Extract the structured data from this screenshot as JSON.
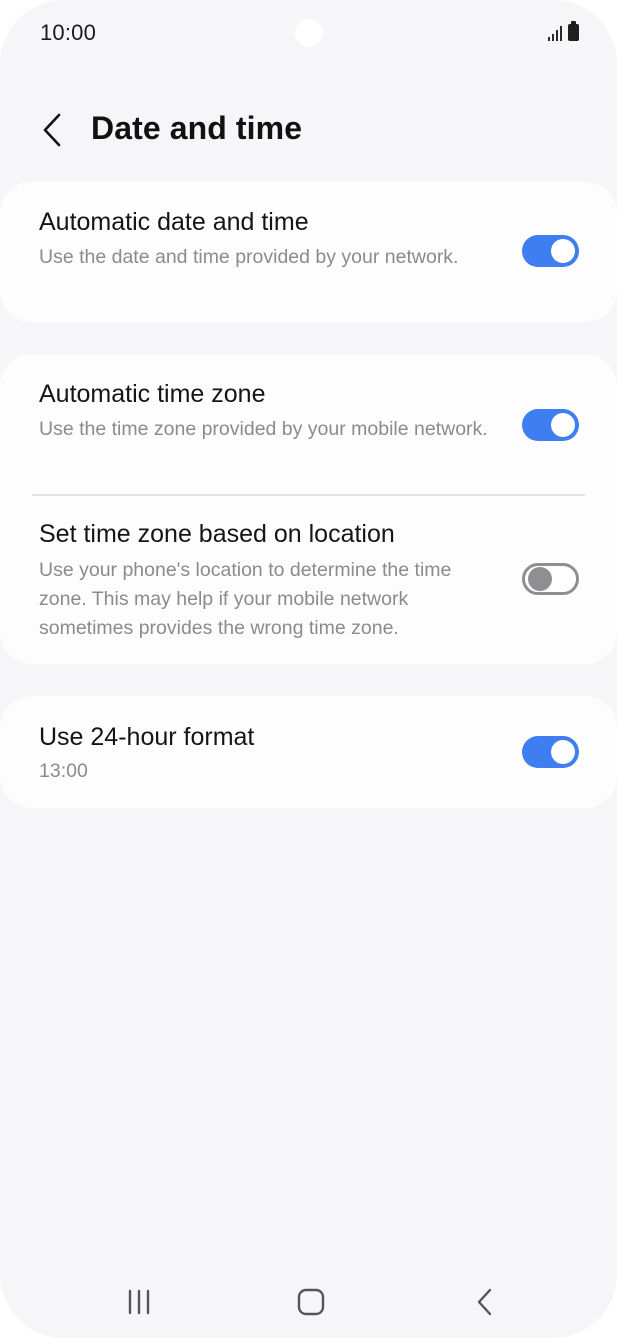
{
  "status_bar": {
    "time": "10:00"
  },
  "header": {
    "title": "Date and time",
    "back_icon": "chevron-left-icon"
  },
  "settings": {
    "automatic_date_time": {
      "title": "Automatic date and time",
      "description": "Use the date and time provided by your network.",
      "enabled": true
    },
    "automatic_time_zone": {
      "title": "Automatic time zone",
      "description": "Use the time zone provided by your mobile network.",
      "enabled": true
    },
    "location_time_zone": {
      "title": "Set time zone based on location",
      "description": "Use your phone's location to determine the time zone. This may help if your mobile network sometimes provides the wrong time zone.",
      "enabled": false
    },
    "hour_format_24": {
      "title": "Use 24-hour format",
      "description": "13:00",
      "enabled": true
    }
  },
  "nav_bar": {
    "recents_icon": "recent-apps-icon",
    "home_icon": "home-icon",
    "back_icon": "back-icon"
  },
  "colors": {
    "accent": "#3e7ef0",
    "background": "#f6f6f8",
    "card": "#fdfdfe"
  }
}
